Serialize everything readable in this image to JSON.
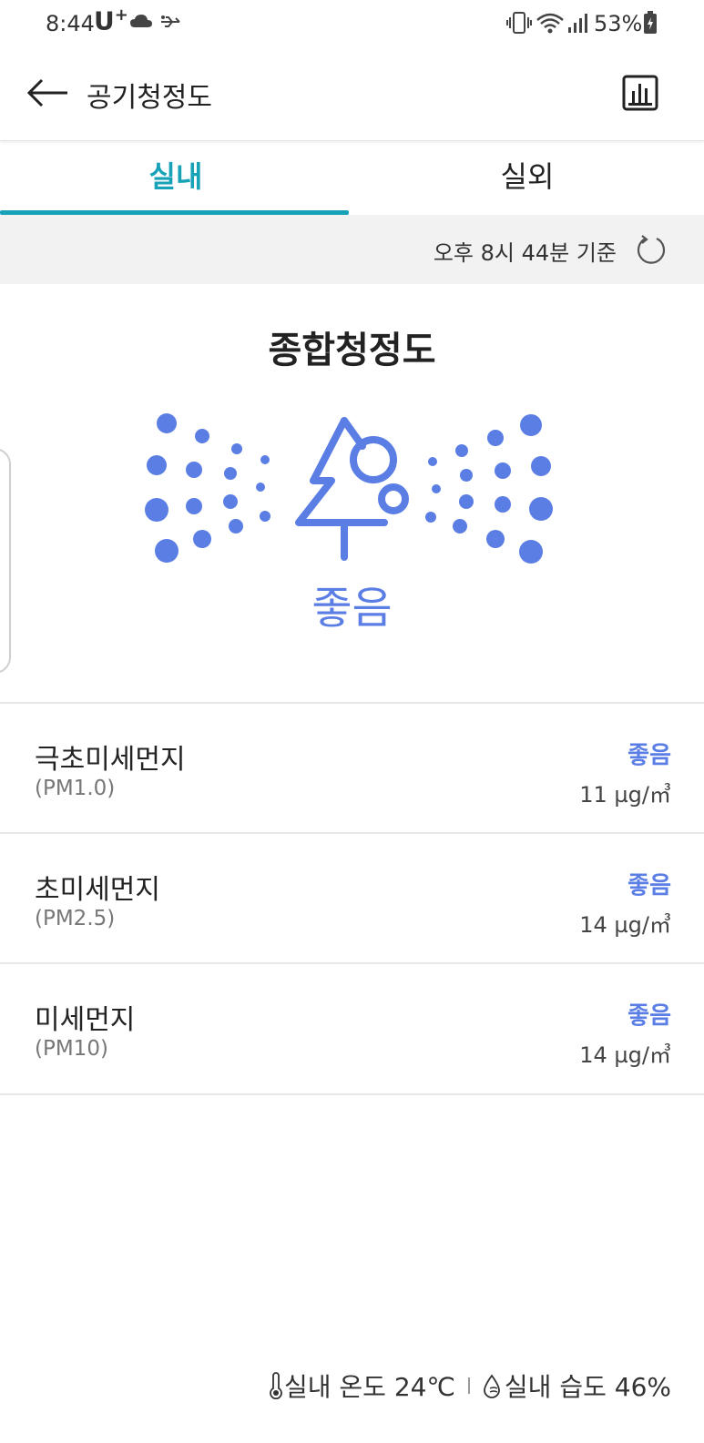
{
  "status_bar": {
    "time": "8:44",
    "carrier": "U",
    "carrier_sup": "+",
    "battery": "53%"
  },
  "header": {
    "title": "공기청정도",
    "back_icon": "arrow-left-icon",
    "chart_icon": "bar-chart-icon"
  },
  "tabs": [
    {
      "label": "실내",
      "active": true
    },
    {
      "label": "실외",
      "active": false
    }
  ],
  "timestamp": "오후 8시 44분 기준",
  "overall": {
    "title": "종합청정도",
    "status": "좋음",
    "icon": "tree-particles-icon"
  },
  "items": [
    {
      "name": "극초미세먼지",
      "code": "(PM1.0)",
      "status": "좋음",
      "value": "11 µg/㎥"
    },
    {
      "name": "초미세먼지",
      "code": "(PM2.5)",
      "status": "좋음",
      "value": "14 µg/㎥"
    },
    {
      "name": "미세먼지",
      "code": "(PM10)",
      "status": "좋음",
      "value": "14 µg/㎥"
    }
  ],
  "footer": {
    "temperature": "실내 온도 24℃",
    "humidity": "실내 습도 46%"
  },
  "colors": {
    "accent": "#17a2b8",
    "good": "#5b7ee5"
  }
}
